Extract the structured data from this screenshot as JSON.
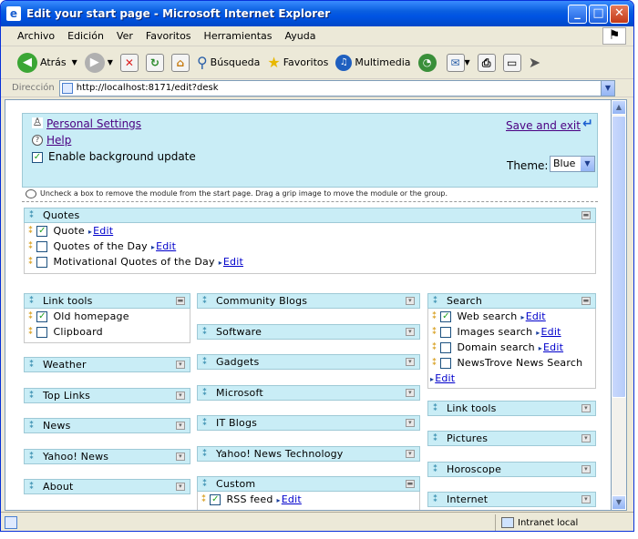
{
  "window": {
    "title": "Edit your start page - Microsoft Internet Explorer"
  },
  "menu": [
    "Archivo",
    "Edición",
    "Ver",
    "Favoritos",
    "Herramientas",
    "Ayuda"
  ],
  "toolbar": {
    "back": "Atrás",
    "search": "Búsqueda",
    "favorites": "Favoritos",
    "media": "Multimedia"
  },
  "address": {
    "label": "Dirección",
    "url": "http://localhost:8171/edit?desk"
  },
  "settings": {
    "personal": "Personal Settings",
    "help": "Help",
    "bg_update": "Enable background update",
    "save_exit": "Save and exit",
    "theme_label": "Theme:",
    "theme_value": "Blue",
    "note": "Uncheck a box to remove the module from the start page. Drag a grip image to move the module or the group."
  },
  "edit_label": "Edit",
  "groups": {
    "quotes": {
      "title": "Quotes",
      "items": [
        "Quote",
        "Quotes of the Day",
        "Motivational Quotes of the Day"
      ]
    },
    "link_tools": {
      "title": "Link tools",
      "items": [
        "Old homepage",
        "Clipboard"
      ]
    },
    "weather": "Weather",
    "top_links": "Top Links",
    "news": "News",
    "yahoo_news": "Yahoo! News",
    "about": "About",
    "community_blogs": "Community Blogs",
    "software": "Software",
    "gadgets": "Gadgets",
    "microsoft": "Microsoft",
    "it_blogs": "IT Blogs",
    "yahoo_news_tech": "Yahoo! News Technology",
    "custom": {
      "title": "Custom",
      "items": [
        "RSS feed"
      ]
    },
    "search": {
      "title": "Search",
      "items": [
        "Web search",
        "Images search",
        "Domain search",
        "NewsTrove News Search"
      ]
    },
    "link_tools_2": "Link tools",
    "pictures": "Pictures",
    "horoscope": "Horoscope",
    "internet": "Internet"
  },
  "status": {
    "zone": "Intranet local"
  }
}
